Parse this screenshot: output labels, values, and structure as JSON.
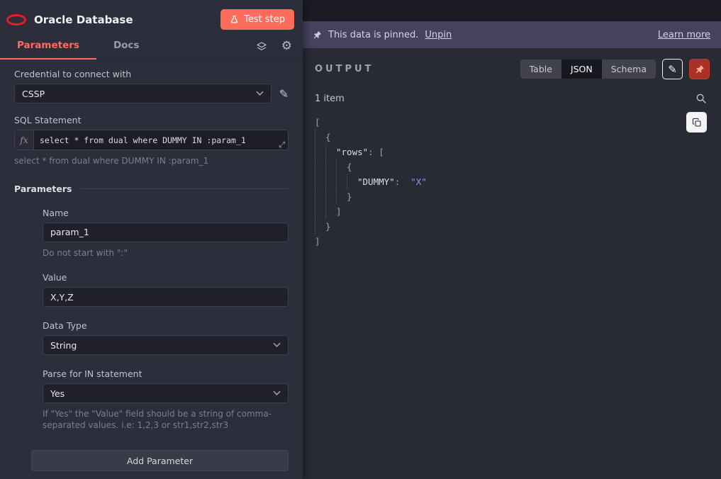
{
  "node": {
    "title": "Oracle Database",
    "test_button_label": "Test step",
    "tabs": [
      {
        "label": "Parameters"
      },
      {
        "label": "Docs"
      }
    ],
    "credential": {
      "label": "Credential to connect with",
      "value": "CSSP"
    },
    "sql": {
      "label": "SQL Statement",
      "expression_prefix": "fx",
      "value": "select * from dual where DUMMY IN :param_1",
      "preview": "select * from dual where DUMMY IN :param_1"
    },
    "parameters_title": "Parameters",
    "param": {
      "name_label": "Name",
      "name_value": "param_1",
      "name_hint": "Do not start with \":\"",
      "value_label": "Value",
      "value_value": "X,Y,Z",
      "datatype_label": "Data Type",
      "datatype_value": "String",
      "parse_label": "Parse for IN statement",
      "parse_value": "Yes",
      "parse_hint": "If \"Yes\" the \"Value\" field should be a string of comma-separated values. i.e: 1,2,3 or str1,str2,str3"
    },
    "add_parameter_label": "Add Parameter"
  },
  "output": {
    "banner": {
      "message": "This data is pinned.",
      "unpin_label": "Unpin",
      "learn_more_label": "Learn more"
    },
    "title": "OUTPUT",
    "view_tabs": [
      {
        "label": "Table",
        "active": false
      },
      {
        "label": "JSON",
        "active": true
      },
      {
        "label": "Schema",
        "active": false
      }
    ],
    "items_count": "1 item",
    "json_lines": [
      {
        "indent": 0,
        "punct": "["
      },
      {
        "indent": 1,
        "punct": "{"
      },
      {
        "indent": 2,
        "key": "\"rows\"",
        "sep": ": ",
        "punct": "["
      },
      {
        "indent": 3,
        "punct": "{"
      },
      {
        "indent": 4,
        "key": "\"DUMMY\"",
        "sep": ":  ",
        "value": "\"X\""
      },
      {
        "indent": 3,
        "punct": "}"
      },
      {
        "indent": 2,
        "punct": "]"
      },
      {
        "indent": 1,
        "punct": "}"
      },
      {
        "indent": 0,
        "punct": "]"
      }
    ]
  },
  "colors": {
    "accent": "#ff6d5a",
    "banner_purple": "#46415f",
    "json_string": "#9d8df2",
    "oracle_red": "#ea1b22"
  }
}
